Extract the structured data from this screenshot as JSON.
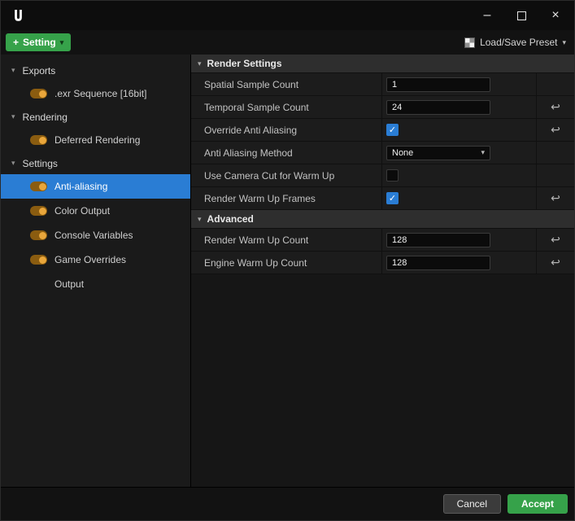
{
  "window": {
    "minimize": "–",
    "close": "×"
  },
  "icons": {
    "chevron_down": "▾",
    "check": "✓",
    "reset": "↩",
    "plus": "+"
  },
  "toolbar": {
    "setting_label": "Setting",
    "preset_label": "Load/Save Preset"
  },
  "sidebar": {
    "groups": [
      {
        "label": "Exports",
        "items": [
          {
            "label": ".exr Sequence [16bit]",
            "toggle": true,
            "selected": false
          }
        ]
      },
      {
        "label": "Rendering",
        "items": [
          {
            "label": "Deferred Rendering",
            "toggle": true,
            "selected": false
          }
        ]
      },
      {
        "label": "Settings",
        "items": [
          {
            "label": "Anti-aliasing",
            "toggle": true,
            "selected": true
          },
          {
            "label": "Color Output",
            "toggle": true,
            "selected": false
          },
          {
            "label": "Console Variables",
            "toggle": true,
            "selected": false
          },
          {
            "label": "Game Overrides",
            "toggle": true,
            "selected": false
          },
          {
            "label": "Output",
            "toggle": false,
            "selected": false
          }
        ]
      }
    ]
  },
  "main": {
    "sections": [
      {
        "label": "Render Settings",
        "rows": [
          {
            "label": "Spatial Sample Count",
            "type": "input",
            "value": "1",
            "reset": false
          },
          {
            "label": "Temporal Sample Count",
            "type": "input",
            "value": "24",
            "reset": true
          },
          {
            "label": "Override Anti Aliasing",
            "type": "checkbox",
            "checked": true,
            "reset": true
          },
          {
            "label": "Anti Aliasing Method",
            "type": "select",
            "value": "None",
            "reset": false
          },
          {
            "label": "Use Camera Cut for Warm Up",
            "type": "checkbox",
            "checked": false,
            "reset": false
          },
          {
            "label": "Render Warm Up Frames",
            "type": "checkbox",
            "checked": true,
            "reset": true
          }
        ]
      },
      {
        "label": "Advanced",
        "rows": [
          {
            "label": "Render Warm Up Count",
            "type": "input",
            "value": "128",
            "reset": true
          },
          {
            "label": "Engine Warm Up Count",
            "type": "input",
            "value": "128",
            "reset": true
          }
        ]
      }
    ]
  },
  "footer": {
    "cancel": "Cancel",
    "accept": "Accept"
  },
  "colors": {
    "accent_green": "#36a24a",
    "selection_blue": "#2a7dd4",
    "toggle_orange": "#e9a63b",
    "checkbox_blue": "#2a7dd4"
  }
}
